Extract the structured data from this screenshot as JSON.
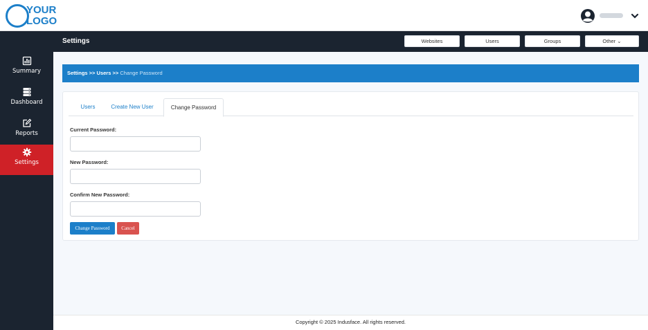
{
  "logo": {
    "line1": "YOUR",
    "line2": "LOGO"
  },
  "user": {
    "avatar_icon": "user-circle-icon",
    "dropdown_icon": "chevron-down-icon"
  },
  "sidebar": {
    "items": [
      {
        "label": "Summary",
        "icon": "summary-chart-icon",
        "active": false
      },
      {
        "label": "Dashboard",
        "icon": "server-stack-icon",
        "active": false
      },
      {
        "label": "Reports",
        "icon": "edit-square-icon",
        "active": false
      },
      {
        "label": "Settings",
        "icon": "gear-icon",
        "active": true
      }
    ],
    "active_color": "#cf2127",
    "background": "#1b2430"
  },
  "header": {
    "title": "Settings",
    "nav": [
      {
        "label": "Websites"
      },
      {
        "label": "Users"
      },
      {
        "label": "Groups"
      },
      {
        "label": "Other ⌄"
      }
    ]
  },
  "breadcrumb": {
    "part1": "Settings",
    "sep1": " >> ",
    "part2": "Users",
    "sep2": " >> ",
    "current": "Change Password"
  },
  "tabs": [
    {
      "label": "Users",
      "active": false
    },
    {
      "label": "Create New User",
      "active": false
    },
    {
      "label": "Change Password",
      "active": true
    }
  ],
  "form": {
    "current_password_label": "Current Password:",
    "current_password_value": "",
    "new_password_label": "New Password:",
    "new_password_value": "",
    "confirm_password_label": "Confirm New Password:",
    "confirm_password_value": "",
    "submit_label": "Change Password",
    "cancel_label": "Cancel"
  },
  "footer": {
    "text": "Copyright © 2025 Indusface. All rights reserved."
  },
  "colors": {
    "accent": "#1c7fc9",
    "danger": "#d9534f"
  }
}
